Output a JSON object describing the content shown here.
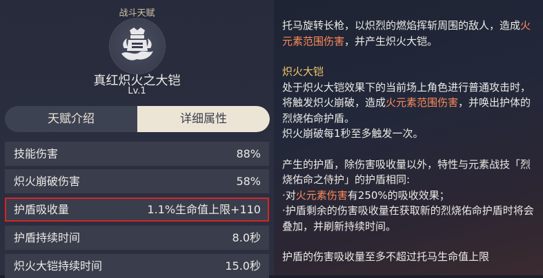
{
  "left": {
    "section_title": "战斗天赋",
    "talent_icon": "flaming-armor-icon",
    "talent_name": "真红炽火之大铠",
    "talent_level": "Lv.1",
    "tabs": {
      "intro": "天赋介绍",
      "detail": "详细属性"
    },
    "stats": [
      {
        "label": "技能伤害",
        "value": "88%"
      },
      {
        "label": "炽火崩破伤害",
        "value": "58%"
      },
      {
        "label": "护盾吸收量",
        "value": "1.1%生命值上限+110",
        "highlighted": true
      },
      {
        "label": "护盾持续时间",
        "value": "8.0秒"
      },
      {
        "label": "炽火大铠持续时间",
        "value": "15.0秒"
      }
    ],
    "highlight_color": "#d62528"
  },
  "right": {
    "p1_a": "托马旋转长枪，以炽烈的燃焰挥斩周围的敌人，造成",
    "p1_fire": "火元素范围伤害",
    "p1_b": "，并产生炽火大铠。",
    "h1": "炽火大铠",
    "p2_a": "处于炽火大铠效果下的当前场上角色进行普通攻击时，将触发炽火崩破，造成",
    "p2_fire": "火元素范围伤害",
    "p2_b": "，并唤出护体的烈烧佑命护盾。",
    "p3": "炽火崩破每1秒至多触发一次。",
    "p4": "产生的护盾，除伤害吸收量以外，特性与元素战技「烈烧佑命之侍护」的护盾相同:",
    "b1_a": "·对",
    "b1_fire": "火元素伤害",
    "b1_b": "有250%的吸收效果；",
    "b2": "·护盾剩余的伤害吸收量在获取新的烈烧佑命护盾时将会叠加，并刷新持续时间。",
    "p5": "护盾的伤害吸收量至多不超过托马生命值上限",
    "colors": {
      "pyro": "#ff8a5a",
      "heading": "#f5c76a"
    }
  }
}
